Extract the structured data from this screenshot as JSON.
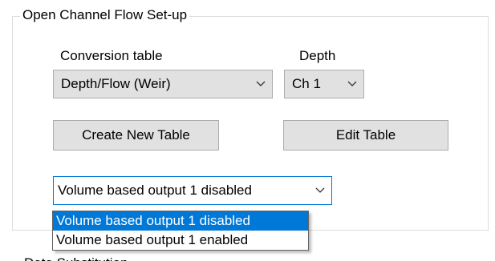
{
  "group": {
    "title": "Open Channel Flow Set-up"
  },
  "conversion": {
    "label": "Conversion table",
    "selected": "Depth/Flow (Weir)"
  },
  "depth": {
    "label": "Depth",
    "selected": "Ch 1"
  },
  "buttons": {
    "create_new_table": "Create New Table",
    "edit_table": "Edit Table"
  },
  "volume_output": {
    "selected": "Volume based output 1 disabled",
    "options": [
      "Volume based output 1 disabled",
      "Volume based output 1 enabled"
    ]
  },
  "next_section": {
    "label": "Data Substitution"
  },
  "colors": {
    "highlight": "#0078d7",
    "button_face": "#e1e1e1",
    "border": "#adadad"
  }
}
